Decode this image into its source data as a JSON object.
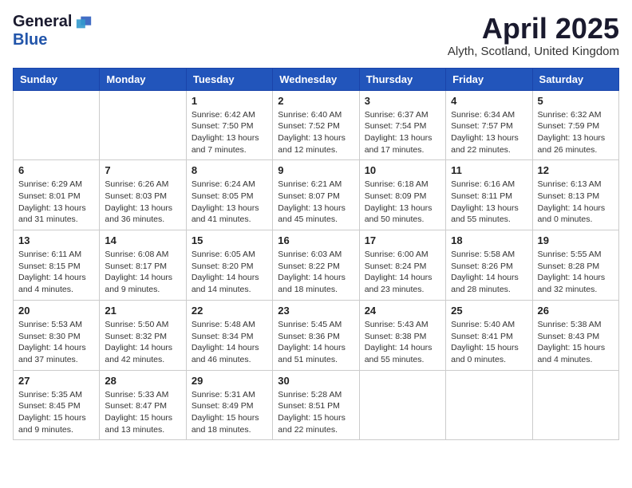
{
  "logo": {
    "general": "General",
    "blue": "Blue"
  },
  "title": "April 2025",
  "location": "Alyth, Scotland, United Kingdom",
  "days_of_week": [
    "Sunday",
    "Monday",
    "Tuesday",
    "Wednesday",
    "Thursday",
    "Friday",
    "Saturday"
  ],
  "weeks": [
    [
      {
        "day": null,
        "info": null
      },
      {
        "day": null,
        "info": null
      },
      {
        "day": "1",
        "info": "Sunrise: 6:42 AM\nSunset: 7:50 PM\nDaylight: 13 hours and 7 minutes."
      },
      {
        "day": "2",
        "info": "Sunrise: 6:40 AM\nSunset: 7:52 PM\nDaylight: 13 hours and 12 minutes."
      },
      {
        "day": "3",
        "info": "Sunrise: 6:37 AM\nSunset: 7:54 PM\nDaylight: 13 hours and 17 minutes."
      },
      {
        "day": "4",
        "info": "Sunrise: 6:34 AM\nSunset: 7:57 PM\nDaylight: 13 hours and 22 minutes."
      },
      {
        "day": "5",
        "info": "Sunrise: 6:32 AM\nSunset: 7:59 PM\nDaylight: 13 hours and 26 minutes."
      }
    ],
    [
      {
        "day": "6",
        "info": "Sunrise: 6:29 AM\nSunset: 8:01 PM\nDaylight: 13 hours and 31 minutes."
      },
      {
        "day": "7",
        "info": "Sunrise: 6:26 AM\nSunset: 8:03 PM\nDaylight: 13 hours and 36 minutes."
      },
      {
        "day": "8",
        "info": "Sunrise: 6:24 AM\nSunset: 8:05 PM\nDaylight: 13 hours and 41 minutes."
      },
      {
        "day": "9",
        "info": "Sunrise: 6:21 AM\nSunset: 8:07 PM\nDaylight: 13 hours and 45 minutes."
      },
      {
        "day": "10",
        "info": "Sunrise: 6:18 AM\nSunset: 8:09 PM\nDaylight: 13 hours and 50 minutes."
      },
      {
        "day": "11",
        "info": "Sunrise: 6:16 AM\nSunset: 8:11 PM\nDaylight: 13 hours and 55 minutes."
      },
      {
        "day": "12",
        "info": "Sunrise: 6:13 AM\nSunset: 8:13 PM\nDaylight: 14 hours and 0 minutes."
      }
    ],
    [
      {
        "day": "13",
        "info": "Sunrise: 6:11 AM\nSunset: 8:15 PM\nDaylight: 14 hours and 4 minutes."
      },
      {
        "day": "14",
        "info": "Sunrise: 6:08 AM\nSunset: 8:17 PM\nDaylight: 14 hours and 9 minutes."
      },
      {
        "day": "15",
        "info": "Sunrise: 6:05 AM\nSunset: 8:20 PM\nDaylight: 14 hours and 14 minutes."
      },
      {
        "day": "16",
        "info": "Sunrise: 6:03 AM\nSunset: 8:22 PM\nDaylight: 14 hours and 18 minutes."
      },
      {
        "day": "17",
        "info": "Sunrise: 6:00 AM\nSunset: 8:24 PM\nDaylight: 14 hours and 23 minutes."
      },
      {
        "day": "18",
        "info": "Sunrise: 5:58 AM\nSunset: 8:26 PM\nDaylight: 14 hours and 28 minutes."
      },
      {
        "day": "19",
        "info": "Sunrise: 5:55 AM\nSunset: 8:28 PM\nDaylight: 14 hours and 32 minutes."
      }
    ],
    [
      {
        "day": "20",
        "info": "Sunrise: 5:53 AM\nSunset: 8:30 PM\nDaylight: 14 hours and 37 minutes."
      },
      {
        "day": "21",
        "info": "Sunrise: 5:50 AM\nSunset: 8:32 PM\nDaylight: 14 hours and 42 minutes."
      },
      {
        "day": "22",
        "info": "Sunrise: 5:48 AM\nSunset: 8:34 PM\nDaylight: 14 hours and 46 minutes."
      },
      {
        "day": "23",
        "info": "Sunrise: 5:45 AM\nSunset: 8:36 PM\nDaylight: 14 hours and 51 minutes."
      },
      {
        "day": "24",
        "info": "Sunrise: 5:43 AM\nSunset: 8:38 PM\nDaylight: 14 hours and 55 minutes."
      },
      {
        "day": "25",
        "info": "Sunrise: 5:40 AM\nSunset: 8:41 PM\nDaylight: 15 hours and 0 minutes."
      },
      {
        "day": "26",
        "info": "Sunrise: 5:38 AM\nSunset: 8:43 PM\nDaylight: 15 hours and 4 minutes."
      }
    ],
    [
      {
        "day": "27",
        "info": "Sunrise: 5:35 AM\nSunset: 8:45 PM\nDaylight: 15 hours and 9 minutes."
      },
      {
        "day": "28",
        "info": "Sunrise: 5:33 AM\nSunset: 8:47 PM\nDaylight: 15 hours and 13 minutes."
      },
      {
        "day": "29",
        "info": "Sunrise: 5:31 AM\nSunset: 8:49 PM\nDaylight: 15 hours and 18 minutes."
      },
      {
        "day": "30",
        "info": "Sunrise: 5:28 AM\nSunset: 8:51 PM\nDaylight: 15 hours and 22 minutes."
      },
      {
        "day": null,
        "info": null
      },
      {
        "day": null,
        "info": null
      },
      {
        "day": null,
        "info": null
      }
    ]
  ]
}
